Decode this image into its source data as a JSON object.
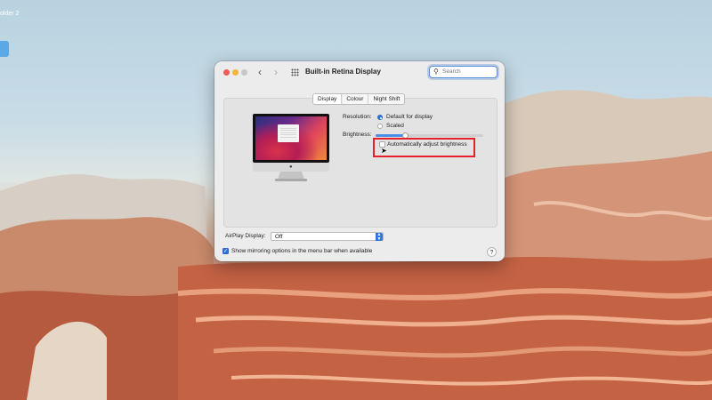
{
  "desktop": {
    "label": "older 2"
  },
  "window": {
    "title": "Built-in Retina Display",
    "search_placeholder": "Search",
    "nav": {
      "back": "‹",
      "forward": "›"
    }
  },
  "tabs": [
    {
      "label": "Display",
      "active": true
    },
    {
      "label": "Colour",
      "active": false
    },
    {
      "label": "Night Shift",
      "active": false
    }
  ],
  "display": {
    "resolution_label": "Resolution:",
    "resolution_options": [
      {
        "label": "Default for display",
        "selected": true
      },
      {
        "label": "Scaled",
        "selected": false
      }
    ],
    "brightness_label": "Brightness:",
    "brightness_level": 0.28,
    "auto_brightness_label": "Automatically adjust brightness",
    "auto_brightness_checked": false
  },
  "airplay": {
    "label": "AirPlay Display:",
    "value": "Off"
  },
  "mirroring": {
    "label": "Show mirroring options in the menu bar when available",
    "checked": true
  },
  "help": {
    "label": "?"
  },
  "colors": {
    "accent": "#2f74e0",
    "highlight_box": "#e4202a"
  }
}
